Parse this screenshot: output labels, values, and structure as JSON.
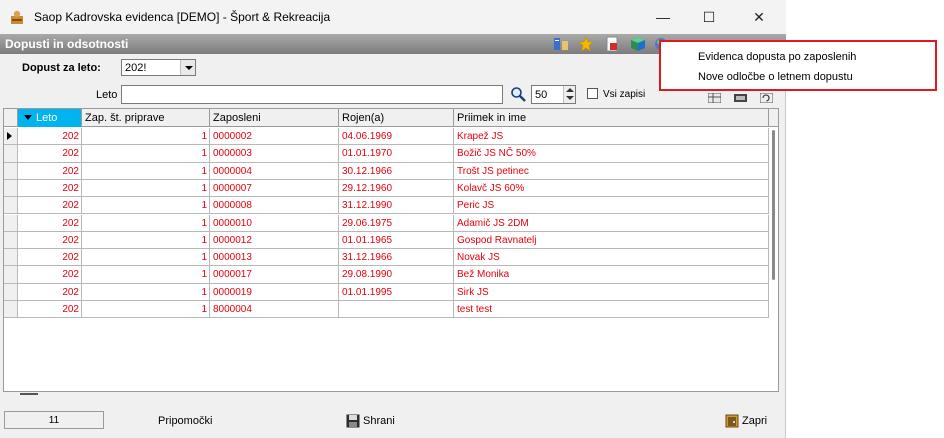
{
  "window": {
    "title": "Saop Kadrovska evidenca [DEMO] - Šport & Rekreacija",
    "minimize_glyph": "—",
    "maximize_glyph": "☐",
    "close_glyph": "✕"
  },
  "section": {
    "title": "Dopusti in odsotnosti"
  },
  "filters": {
    "year_label": "Dopust za leto:",
    "year_value": "202!",
    "leto_label": "Leto",
    "leto_value": "",
    "page_size": "50",
    "all_records_label": "Vsi zapisi"
  },
  "grid": {
    "columns": [
      "Leto",
      "Zap. št. priprave",
      "Zaposleni",
      "Rojen(a)",
      "Priimek in ime"
    ],
    "rows": [
      {
        "leto": "202",
        "zap": "1",
        "zaposleni": "0000002",
        "rojen": "04.06.1969",
        "ime": "Krapež JS"
      },
      {
        "leto": "202",
        "zap": "1",
        "zaposleni": "0000003",
        "rojen": "01.01.1970",
        "ime": "Božič JS NČ 50%"
      },
      {
        "leto": "202",
        "zap": "1",
        "zaposleni": "0000004",
        "rojen": "30.12.1966",
        "ime": "Trošt JS petinec"
      },
      {
        "leto": "202",
        "zap": "1",
        "zaposleni": "0000007",
        "rojen": "29.12.1960",
        "ime": "Kolavč JS 60%"
      },
      {
        "leto": "202",
        "zap": "1",
        "zaposleni": "0000008",
        "rojen": "31.12.1990",
        "ime": "Peric JS"
      },
      {
        "leto": "202",
        "zap": "1",
        "zaposleni": "0000010",
        "rojen": "29.06.1975",
        "ime": "Adamič JS 2DM"
      },
      {
        "leto": "202",
        "zap": "1",
        "zaposleni": "0000012",
        "rojen": "01.01.1965",
        "ime": "Gospod Ravnatelj"
      },
      {
        "leto": "202",
        "zap": "1",
        "zaposleni": "0000013",
        "rojen": "31.12.1966",
        "ime": "Novak JS"
      },
      {
        "leto": "202",
        "zap": "1",
        "zaposleni": "0000017",
        "rojen": "29.08.1990",
        "ime": "Bež Monika"
      },
      {
        "leto": "202",
        "zap": "1",
        "zaposleni": "0000019",
        "rojen": "01.01.1995",
        "ime": "Sirk JS"
      },
      {
        "leto": "202",
        "zap": "1",
        "zaposleni": "8000004",
        "rojen": "",
        "ime": "test test"
      }
    ]
  },
  "status": {
    "count": "11",
    "tools_label": "Pripomočki",
    "save_label": "Shrani",
    "close_label": "Zapri"
  },
  "menu": {
    "items": [
      "Evidenca dopusta po zaposlenih",
      "Nove odločbe o letnem dopustu"
    ]
  },
  "colors": {
    "row_text": "#e8000b",
    "sorted_header": "#00b4f0",
    "menu_border": "#e0191e",
    "section_header": "#8a8a8a"
  }
}
